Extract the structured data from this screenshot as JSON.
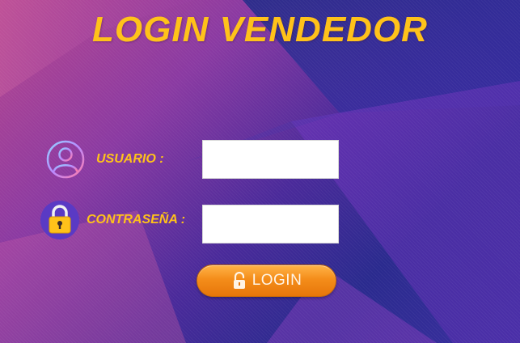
{
  "page": {
    "title": "LOGIN VENDEDOR"
  },
  "form": {
    "user_label": "USUARIO :",
    "user_icon": "user-icon",
    "user_value": "",
    "password_label": "CONTRASEÑA :",
    "password_icon": "lock-icon",
    "password_value": "",
    "submit_label": "LOGIN",
    "submit_icon": "unlock-icon"
  },
  "colors": {
    "accent": "#ffc21a",
    "button": "#f48d1a",
    "background_dark": "#2a2a8e",
    "background_light": "#b8478f"
  }
}
